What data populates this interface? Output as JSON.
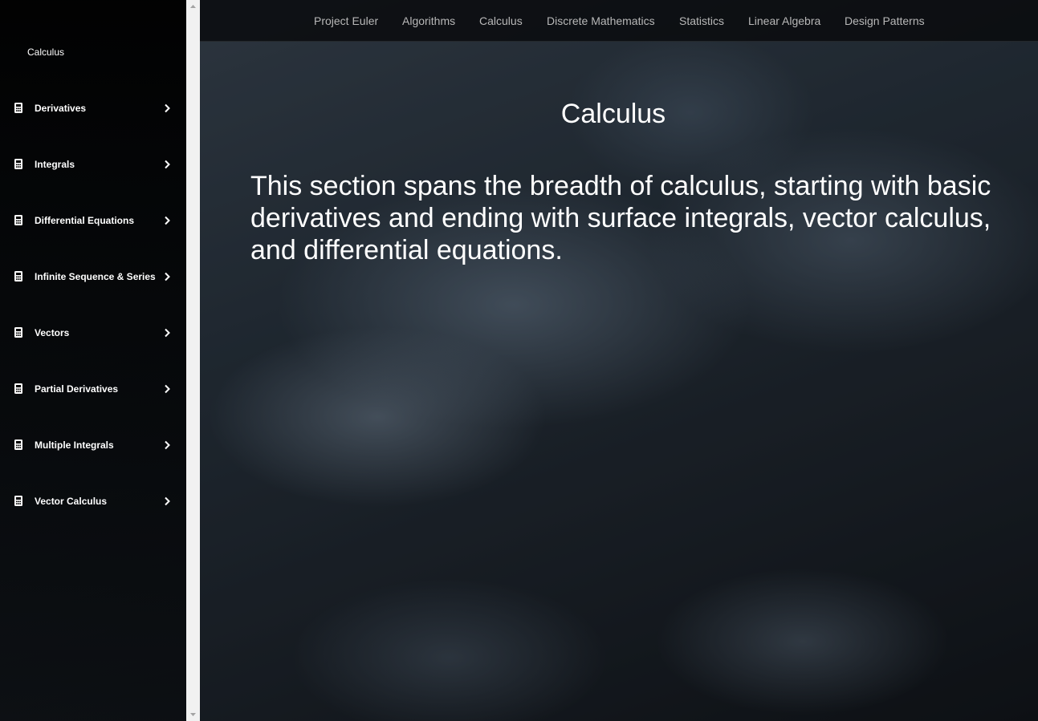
{
  "sidebar": {
    "title": "Calculus",
    "items": [
      {
        "label": "Derivatives"
      },
      {
        "label": "Integrals"
      },
      {
        "label": "Differential Equations"
      },
      {
        "label": "Infinite Sequence & Series"
      },
      {
        "label": "Vectors"
      },
      {
        "label": "Partial Derivatives"
      },
      {
        "label": "Multiple Integrals"
      },
      {
        "label": "Vector Calculus"
      }
    ]
  },
  "nav": {
    "links": [
      {
        "label": "Project Euler"
      },
      {
        "label": "Algorithms"
      },
      {
        "label": "Calculus"
      },
      {
        "label": "Discrete Mathematics"
      },
      {
        "label": "Statistics"
      },
      {
        "label": "Linear Algebra"
      },
      {
        "label": "Design Patterns"
      }
    ]
  },
  "main": {
    "title": "Calculus",
    "description": "This section spans the breadth of calculus, starting with basic derivatives and ending with surface integrals, vector calculus, and differential equations."
  },
  "icons": {
    "sidebar_item": "calculator-icon",
    "sidebar_arrow": "chevron-right-icon",
    "scroll_up": "scroll-up-arrow-icon",
    "scroll_down": "scroll-down-arrow-icon"
  },
  "colors": {
    "sidebar_bg": "#000000",
    "text": "#ffffff",
    "nav_text": "#b8b8b8"
  }
}
